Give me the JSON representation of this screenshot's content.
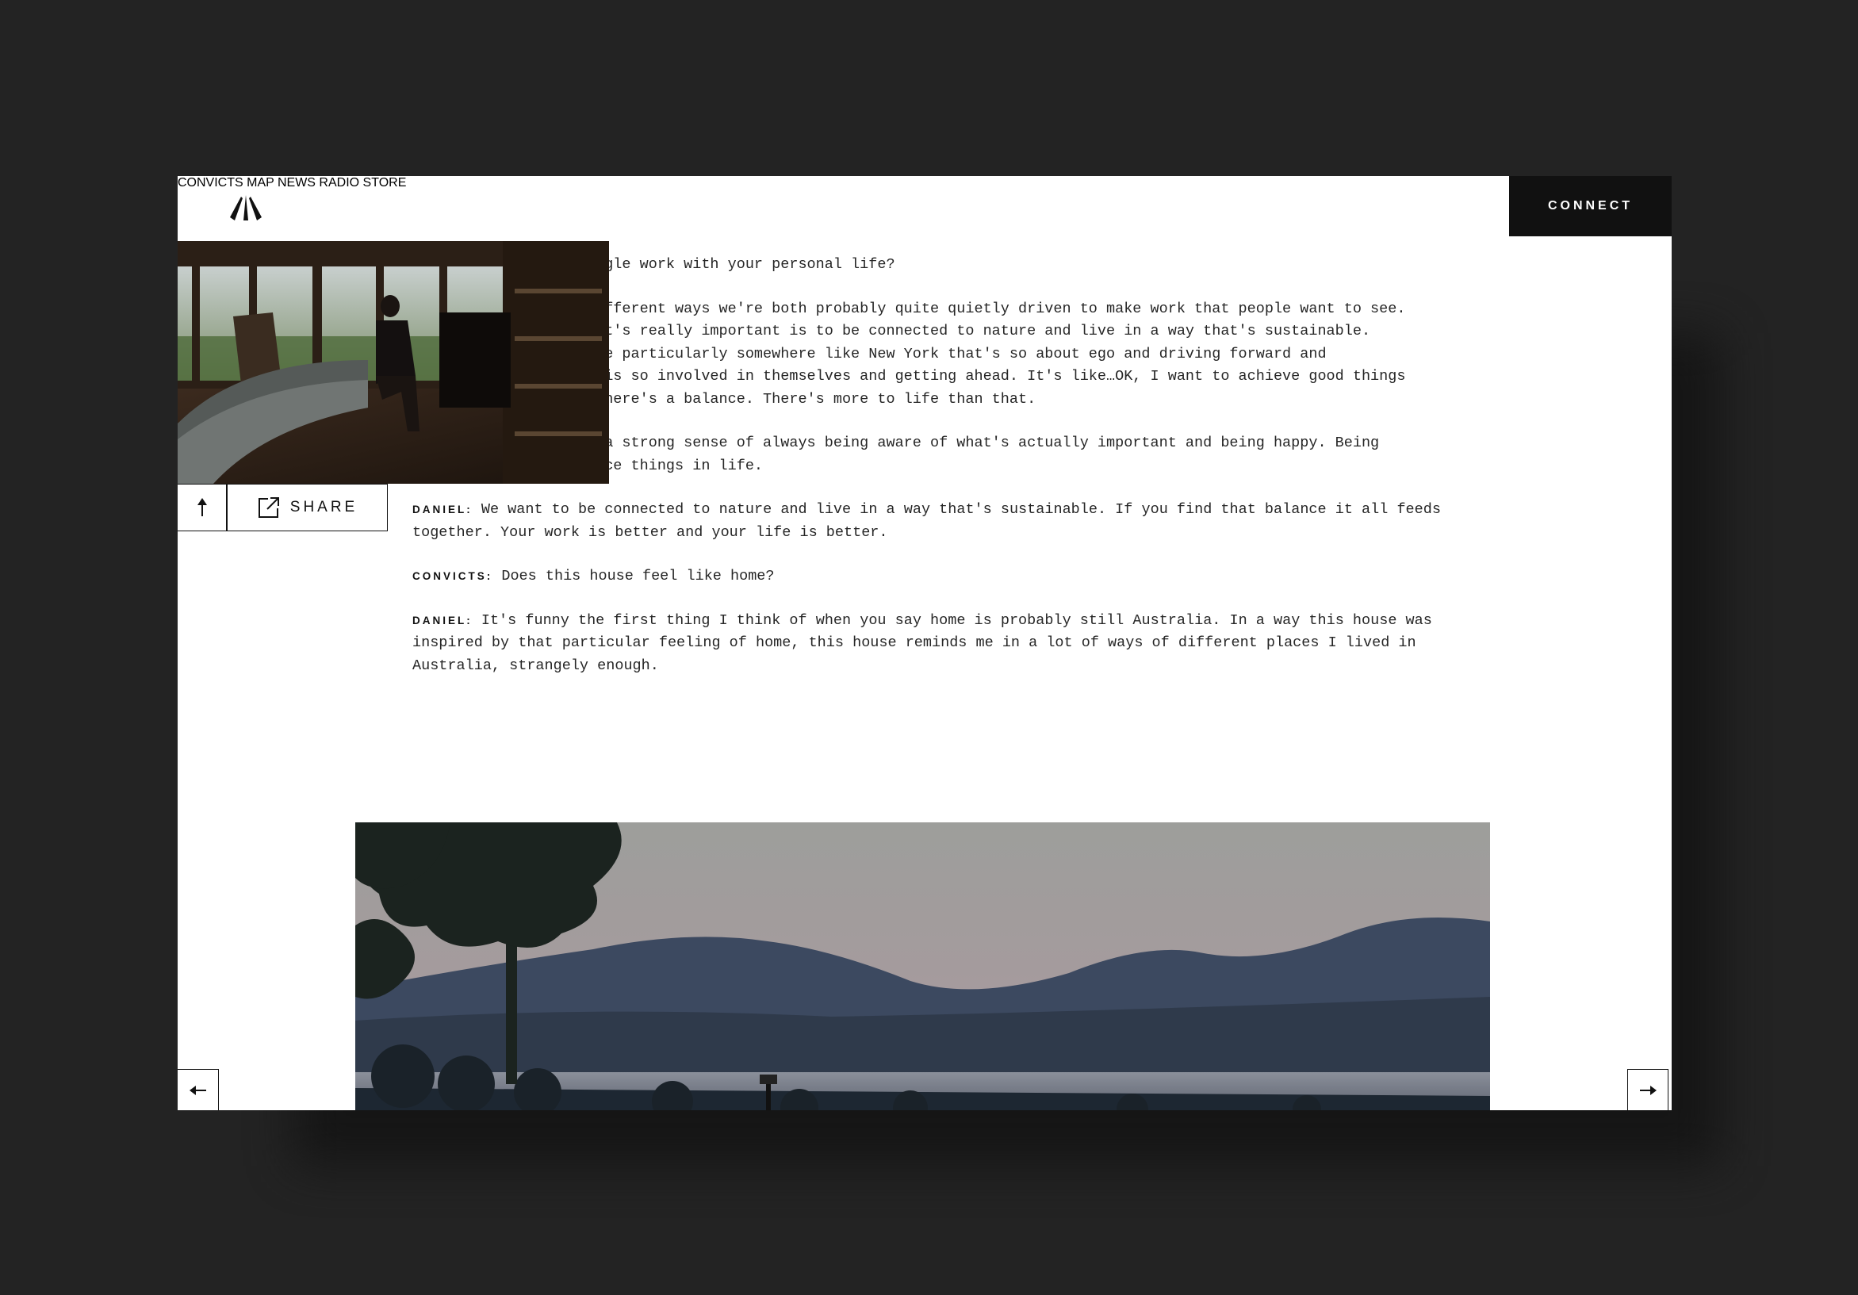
{
  "nav": {
    "items": [
      {
        "label": "CONVICTS"
      },
      {
        "label": "MAP"
      },
      {
        "label": "NEWS"
      },
      {
        "label": "RADIO"
      },
      {
        "label": "STORE"
      }
    ],
    "connect_label": "CONNECT"
  },
  "article": {
    "lines": [
      "uggle work with your personal life?",
      "different ways we're both probably quite quietly driven to make work that people want to see.",
      "hat's really important is to be connected to nature and live in a way that's sustainable.",
      "nce particularly somewhere like New York that's so about ego and driving forward and",
      "e is so involved in themselves and getting ahead. It's like…OK, I want to achieve good things",
      " there's a balance. There's more to life than that.",
      "; a strong sense of always being aware of what's actually important and being happy. Being",
      "nice things in life."
    ],
    "daniel_1": {
      "speaker": "DANIEL:",
      "line1": " We want to be connected to nature and live in a way that's sustainable. If you find that balance it all feeds",
      "line2": "together. Your work is better and your life is better."
    },
    "convicts_1": {
      "speaker": "CONVICTS:",
      "text": " Does this house feel like home?"
    },
    "daniel_2": {
      "speaker": "DANIEL:",
      "line1": " It's funny the first thing I think of when you say home is probably still Australia. In a way this house was",
      "line2": "inspired by that particular feeling of home, this house reminds me in a lot of ways of different places I lived in",
      "line3": "Australia, strangely enough."
    }
  },
  "share": {
    "label": "SHARE"
  },
  "icons": {
    "logo": "brand-logo-icon",
    "up": "arrow-up-icon",
    "share": "share-external-icon",
    "prev": "arrow-left-icon",
    "next": "arrow-right-icon"
  },
  "colors": {
    "background": "#232323",
    "page": "#ffffff",
    "connect_bg": "#111111",
    "text": "#262626"
  }
}
